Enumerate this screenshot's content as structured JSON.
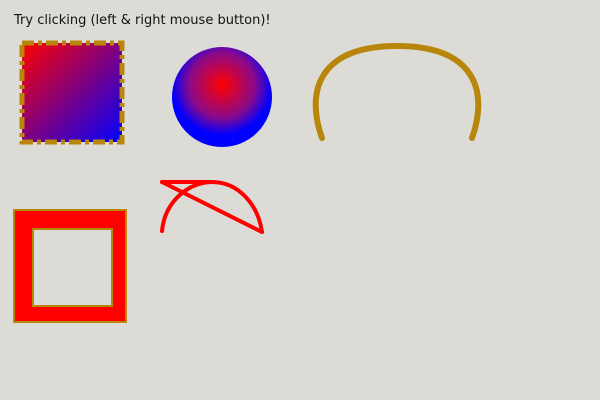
{
  "instruction_text": "Try clicking (left & right mouse button)!",
  "colors": {
    "background": "#dcdbd6",
    "gold": "#b8860b",
    "red": "#ff0000",
    "blue": "#0000ff"
  },
  "shapes": [
    {
      "name": "gradient-square",
      "kind": "square",
      "fill": "linear gradient red to blue",
      "border": "dash-dot",
      "border_color": "#b8860b"
    },
    {
      "name": "gradient-circle",
      "kind": "circle",
      "fill": "radial gradient red to blue"
    },
    {
      "name": "gold-arc",
      "kind": "arc",
      "stroke": "#b8860b"
    },
    {
      "name": "red-crossed-arc",
      "kind": "arc with crossing chord lines",
      "stroke": "#ff0000"
    },
    {
      "name": "red-frame",
      "kind": "hollow square frame",
      "fill": "#ff0000",
      "border_color": "#b8860b"
    }
  ]
}
